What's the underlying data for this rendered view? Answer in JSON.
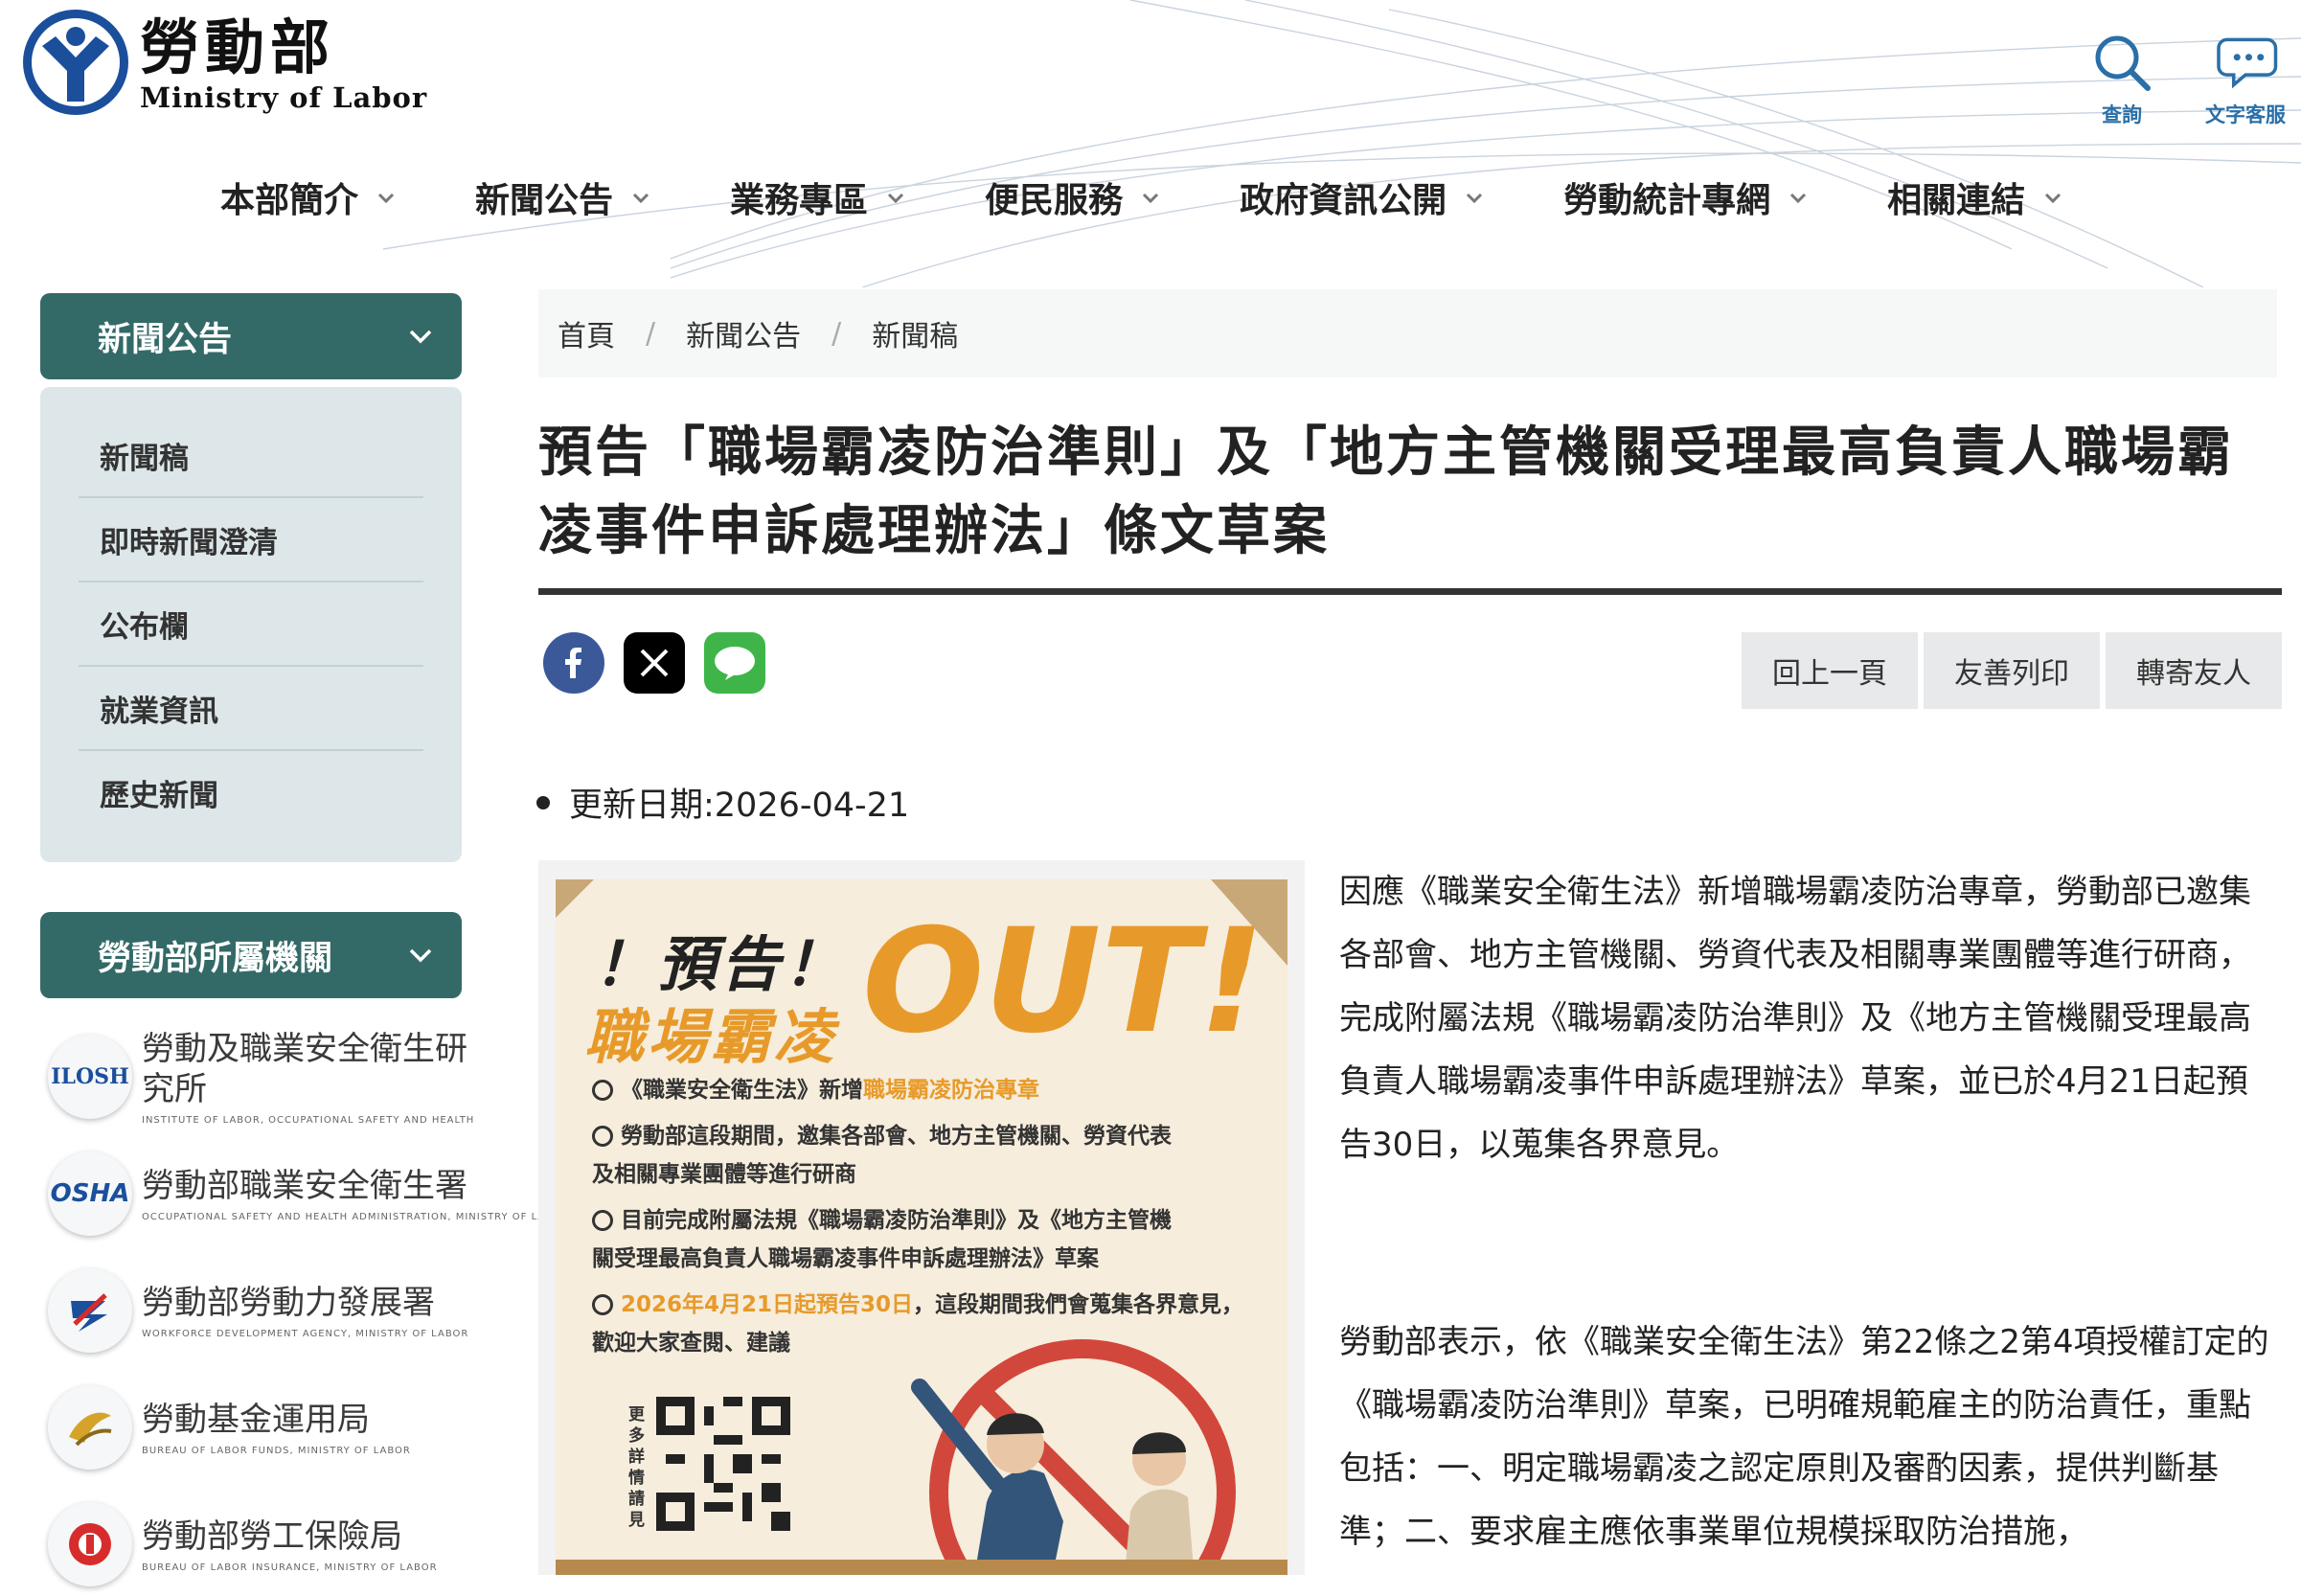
{
  "header": {
    "logo_zh": "勞動部",
    "logo_en": "Ministry of Labor",
    "tools": [
      {
        "label": "查詢",
        "icon": "search-icon"
      },
      {
        "label": "文字客服",
        "icon": "chat-icon"
      }
    ]
  },
  "nav": {
    "items": [
      "本部簡介",
      "新聞公告",
      "業務專區",
      "便民服務",
      "政府資訊公開",
      "勞動統計專網",
      "相關連結"
    ]
  },
  "sidebar": {
    "section_title": "新聞公告",
    "links": [
      "新聞稿",
      "即時新聞澄清",
      "公布欄",
      "就業資訊",
      "歷史新聞"
    ],
    "agencies_title": "勞動部所屬機關",
    "agencies": [
      {
        "zh": "勞動及職業安全衛生研究所",
        "en": "INSTITUTE OF LABOR, OCCUPATIONAL SAFETY AND HEALTH",
        "mark": "ILOSH"
      },
      {
        "zh": "勞動部職業安全衛生署",
        "en": "OCCUPATIONAL SAFETY AND HEALTH ADMINISTRATION, MINISTRY OF LABOR",
        "mark": "OSHA"
      },
      {
        "zh": "勞動部勞動力發展署",
        "en": "WORKFORCE DEVELOPMENT AGENCY, MINISTRY OF LABOR",
        "mark": ""
      },
      {
        "zh": "勞動基金運用局",
        "en": "BUREAU OF LABOR FUNDS, MINISTRY OF LABOR",
        "mark": ""
      },
      {
        "zh": "勞動部勞工保險局",
        "en": "BUREAU OF LABOR INSURANCE, MINISTRY OF LABOR",
        "mark": ""
      }
    ]
  },
  "breadcrumb": [
    "首頁",
    "新聞公告",
    "新聞稿"
  ],
  "article": {
    "title": "預告「職場霸凌防治準則」及「地方主管機關受理最高負責人職場霸凌事件申訴處理辦法」條文草案",
    "actions": [
      "回上一頁",
      "友善列印",
      "轉寄友人"
    ],
    "share": [
      "facebook",
      "x",
      "line"
    ],
    "update_label": "更新日期:2026-04-21",
    "paragraphs": [
      "因應《職業安全衛生法》新增職場霸凌防治專章，勞動部已邀集各部會、地方主管機關、勞資代表及相關專業團體等進行研商，完成附屬法規《職場霸凌防治準則》及《地方主管機關受理最高負責人職場霸凌事件申訴處理辦法》草案，並已於4月21日起預告30日，以蒐集各界意見。",
      "勞動部表示，依《職業安全衛生法》第22條之2第4項授權訂定的《職場霸凌防治準則》草案，已明確規範雇主的防治責任，重點包括：一、明定職場霸凌之認定原則及審酌因素，提供判斷基準；二、要求雇主應依事業單位規模採取防治措施，"
    ]
  },
  "poster": {
    "headline1": "！預告！",
    "headline2": "職場霸凌",
    "out": "OUT!",
    "items": [
      {
        "a": "《職業安全衛生法》新增",
        "hl": "職場霸凌防治專章",
        "b": ""
      },
      {
        "a": "勞動部這段期間，邀集各部會、地方主管機關、勞資代表",
        "hl": "",
        "b": "及相關專業團體等進行研商"
      },
      {
        "a": "目前完成附屬法規《職場霸凌防治準則》及《地方主管機",
        "hl": "",
        "b": "關受理最高負責人職場霸凌事件申訴處理辦法》草案"
      },
      {
        "a": "",
        "hl": "2026年4月21日起預告30日",
        "b": "，這段期間我們會蒐集各界意見，歡迎大家查閱、建議"
      }
    ],
    "qr_label": "更多詳情請見"
  },
  "colors": {
    "primary": "#336a67",
    "poster_orange": "#e79a2a",
    "poster_bg": "#f6eddc",
    "link_blue": "#2a6fa8"
  }
}
